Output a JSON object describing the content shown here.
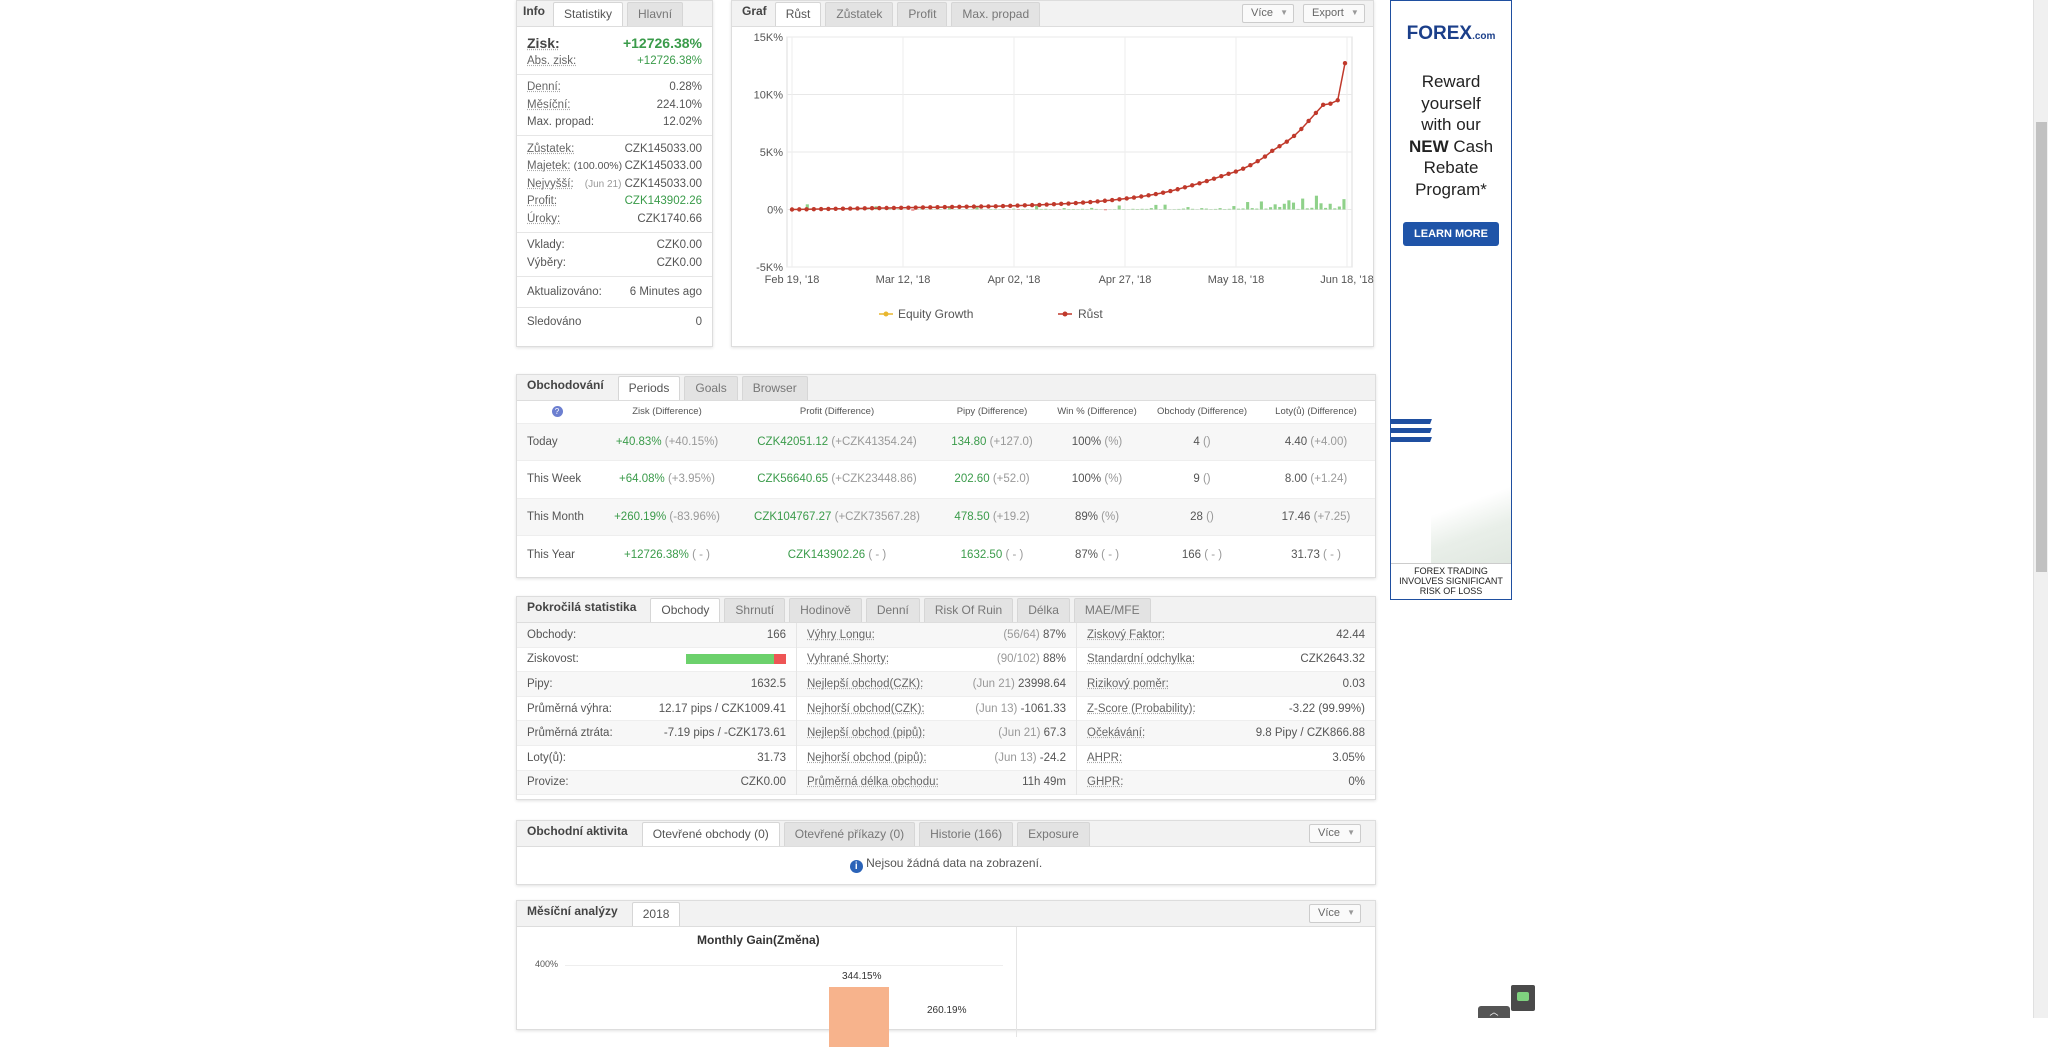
{
  "info_panel": {
    "tabs": [
      "Info",
      "Statistiky",
      "Hlavní"
    ],
    "gain_label": "Zisk:",
    "gain_value": "+12726.38%",
    "abs_gain_label": "Abs. zisk:",
    "abs_gain_value": "+12726.38%",
    "daily_label": "Denní:",
    "daily_value": "0.28%",
    "monthly_label": "Měsíční:",
    "monthly_value": "224.10%",
    "drawdown_label": "Max. propad:",
    "drawdown_value": "12.02%",
    "balance_label": "Zůstatek:",
    "balance_value": "CZK145033.00",
    "equity_label": "Majetek:",
    "equity_note": "(100.00%)",
    "equity_value": "CZK145033.00",
    "highest_label": "Nejvyšší:",
    "highest_note": "(Jun 21)",
    "highest_value": "CZK145033.00",
    "profit_label": "Profit:",
    "profit_value": "CZK143902.26",
    "interest_label": "Úroky:",
    "interest_value": "CZK1740.66",
    "deposits_label": "Vklady:",
    "deposits_value": "CZK0.00",
    "withdrawals_label": "Výběry:",
    "withdrawals_value": "CZK0.00",
    "updated_label": "Aktualizováno:",
    "updated_value": "6 Minutes ago",
    "tracked_label": "Sledováno",
    "tracked_value": "0"
  },
  "graph_panel": {
    "title": "Graf",
    "tabs": [
      "Růst",
      "Zůstatek",
      "Profit",
      "Max. propad"
    ],
    "more_label": "Více",
    "export_label": "Export"
  },
  "chart_data": {
    "type": "bar",
    "x_ticks": [
      "Feb 19, '18",
      "Mar 12, '18",
      "Apr 02, '18",
      "Apr 27, '18",
      "May 18, '18",
      "Jun 18, '18"
    ],
    "y_ticks": [
      "15K%",
      "10K%",
      "5K%",
      "0%",
      "-5K%"
    ],
    "ylim": [
      -5000,
      15000
    ],
    "legend": [
      "Equity Growth",
      "Růst"
    ],
    "colors": {
      "bars": "#8fd18a",
      "bars_negative": "#e05555",
      "line": "#c0392b",
      "equity": "#e8b730"
    },
    "bars": [
      60,
      0,
      35,
      450,
      50,
      90,
      70,
      120,
      80,
      10,
      30,
      20,
      80,
      25,
      110,
      10,
      40,
      25,
      280,
      10,
      20,
      60,
      30,
      50,
      10,
      220,
      -90,
      30,
      150,
      20,
      40,
      25,
      35,
      10,
      280,
      20,
      20,
      10,
      20,
      25,
      250,
      30,
      10,
      40,
      40,
      30,
      15,
      -20,
      70,
      -40,
      35,
      30,
      20,
      320,
      50,
      60,
      30,
      15,
      -20,
      120,
      40,
      45,
      30,
      60,
      30,
      140,
      50,
      20,
      -60,
      20,
      30,
      350,
      40,
      20,
      60,
      40,
      60,
      50,
      120,
      400,
      30,
      420,
      20,
      30,
      50,
      80,
      210,
      60,
      20,
      120,
      80,
      30,
      50,
      120,
      40,
      60,
      300,
      70,
      90,
      650,
      120,
      80,
      700,
      80,
      200,
      450,
      220,
      500,
      800,
      600,
      50,
      950,
      100,
      150,
      1200,
      540,
      140,
      500,
      100,
      260,
      900
    ],
    "growth": [
      0,
      10,
      20,
      30,
      40,
      50,
      60,
      70,
      80,
      90,
      100,
      110,
      120,
      130,
      140,
      150,
      160,
      170,
      180,
      190,
      200,
      210,
      220,
      230,
      240,
      250,
      260,
      270,
      280,
      300,
      320,
      340,
      360,
      380,
      400,
      430,
      460,
      490,
      520,
      560,
      600,
      650,
      700,
      760,
      820,
      890,
      960,
      1040,
      1130,
      1230,
      1340,
      1460,
      1600,
      1760,
      1930,
      2100,
      2280,
      2470,
      2680,
      2900,
      3100,
      3300,
      3550,
      3850,
      4200,
      4600,
      5100,
      5500,
      5900,
      6400,
      7000,
      7700,
      8400,
      9100,
      9200,
      9500,
      12726
    ]
  },
  "trading_panel": {
    "title": "Obchodování",
    "tabs": [
      "Periods",
      "Goals",
      "Browser"
    ],
    "columns": [
      "Zisk (Difference)",
      "Profit (Difference)",
      "Pipy (Difference)",
      "Win % (Difference)",
      "Obchody (Difference)",
      "Loty(ů) (Difference)"
    ],
    "rows": [
      {
        "period": "Today",
        "gain": "+40.83%",
        "gain_diff": "(+40.15%)",
        "profit": "CZK42051.12",
        "profit_diff": "(+CZK41354.24)",
        "pips": "134.80",
        "pips_diff": "(+127.0)",
        "win": "100%",
        "win_diff": "(%)",
        "trades": "4",
        "trades_diff": "()",
        "lots": "4.40",
        "lots_diff": "(+4.00)"
      },
      {
        "period": "This Week",
        "gain": "+64.08%",
        "gain_diff": "(+3.95%)",
        "profit": "CZK56640.65",
        "profit_diff": "(+CZK23448.86)",
        "pips": "202.60",
        "pips_diff": "(+52.0)",
        "win": "100%",
        "win_diff": "(%)",
        "trades": "9",
        "trades_diff": "()",
        "lots": "8.00",
        "lots_diff": "(+1.24)"
      },
      {
        "period": "This Month",
        "gain": "+260.19%",
        "gain_diff": "(-83.96%)",
        "profit": "CZK104767.27",
        "profit_diff": "(+CZK73567.28)",
        "pips": "478.50",
        "pips_diff": "(+19.2)",
        "win": "89%",
        "win_diff": "(%)",
        "trades": "28",
        "trades_diff": "()",
        "lots": "17.46",
        "lots_diff": "(+7.25)"
      },
      {
        "period": "This Year",
        "gain": "+12726.38%",
        "gain_diff": "( - )",
        "profit": "CZK143902.26",
        "profit_diff": "( - )",
        "pips": "1632.50",
        "pips_diff": "( - )",
        "win": "87%",
        "win_diff": "( - )",
        "trades": "166",
        "trades_diff": "( - )",
        "lots": "31.73",
        "lots_diff": "( - )"
      }
    ]
  },
  "advanced_panel": {
    "title": "Pokročilá statistika",
    "tabs": [
      "Obchody",
      "Shrnutí",
      "Hodinově",
      "Denní",
      "Risk Of Ruin",
      "Délka",
      "MAE/MFE"
    ],
    "col1": [
      {
        "label": "Obchody:",
        "value": "166"
      },
      {
        "label": "Ziskovost:",
        "value": ""
      },
      {
        "label": "Pipy:",
        "value": "1632.5"
      },
      {
        "label": "Průměrná výhra:",
        "value": "12.17 pips / CZK1009.41"
      },
      {
        "label": "Průměrná ztráta:",
        "value": "-7.19 pips / -CZK173.61"
      },
      {
        "label": "Loty(ů):",
        "value": "31.73"
      },
      {
        "label": "Provize:",
        "value": "CZK0.00"
      }
    ],
    "col2": [
      {
        "label": "Výhry Longu:",
        "note": "(56/64)",
        "value": "87%"
      },
      {
        "label": "Vyhrané Shorty:",
        "note": "(90/102)",
        "value": "88%"
      },
      {
        "label": "Nejlepší obchod(CZK):",
        "note": "(Jun 21)",
        "value": "23998.64"
      },
      {
        "label": "Nejhorší obchod(CZK):",
        "note": "(Jun 13)",
        "value": "-1061.33"
      },
      {
        "label": "Nejlepší obchod (pipů):",
        "note": "(Jun 21)",
        "value": "67.3"
      },
      {
        "label": "Nejhorší obchod (pipů):",
        "note": "(Jun 13)",
        "value": "-24.2"
      },
      {
        "label": "Průměrná délka obchodu:",
        "note": "",
        "value": "11h 49m"
      }
    ],
    "col3": [
      {
        "label": "Ziskový Faktor:",
        "value": "42.44"
      },
      {
        "label": "Standardní odchylka:",
        "value": "CZK2643.32"
      },
      {
        "label": "Rizikový poměr:",
        "value": "0.03"
      },
      {
        "label": "Z-Score (Probability):",
        "value": "-3.22 (99.99%)"
      },
      {
        "label": "Očekávání:",
        "value": "9.8 Pipy / CZK866.88"
      },
      {
        "label": "AHPR:",
        "value": "3.05%"
      },
      {
        "label": "GHPR:",
        "value": "0%"
      }
    ],
    "profitability": 0.88
  },
  "activity_panel": {
    "title": "Obchodní aktivita",
    "tabs": [
      "Otevřené obchody (0)",
      "Otevřené příkazy (0)",
      "Historie (166)",
      "Exposure"
    ],
    "more_label": "Více",
    "empty_message": "Nejsou žádná data na zobrazení."
  },
  "monthly_panel": {
    "title": "Měsíční analýzy",
    "tabs": [
      "2018"
    ],
    "more_label": "Více",
    "chart_title": "Monthly Gain(Změna)",
    "y_tick": "400%",
    "bar1_label": "344.15%",
    "bar2_label": "260.19%"
  },
  "ad": {
    "logo_main": "F",
    "logo_o": "O",
    "logo_rest": "REX",
    "logo_suffix": ".com",
    "line1": "Reward",
    "line2": "yourself",
    "line3": "with our",
    "line4_bold": "NEW",
    "line4_rest": " Cash",
    "line5": "Rebate",
    "line6": "Program*",
    "button": "LEARN MORE",
    "disclaimer": "FOREX TRADING INVOLVES SIGNIFICANT RISK OF LOSS"
  }
}
